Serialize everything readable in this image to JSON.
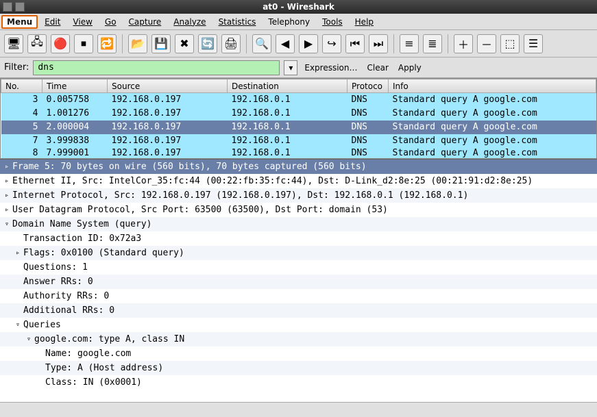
{
  "window": {
    "title": "at0 - Wireshark"
  },
  "menubar": {
    "menu_button": "Menu",
    "items": [
      "Edit",
      "View",
      "Go",
      "Capture",
      "Analyze",
      "Statistics",
      "Telephony",
      "Tools",
      "Help"
    ]
  },
  "toolbar_icons": {
    "if_list": "🖥",
    "if_opts": "🖧",
    "start": "🔴",
    "stop": "⏹",
    "restart": "🔁",
    "open": "📂",
    "save": "💾",
    "close": "✖",
    "reload": "🔄",
    "print": "🖨",
    "find": "🔍",
    "back": "◀",
    "fwd": "▶",
    "goto": "↪",
    "first": "⏮",
    "last": "⏭",
    "colorize": "≡",
    "autoscroll": "≣",
    "zoom_in": "＋",
    "zoom_out": "－",
    "zoom_100": "⬚",
    "cols": "☰"
  },
  "filter": {
    "label": "Filter:",
    "value": "dns",
    "expression": "Expression…",
    "clear": "Clear",
    "apply": "Apply"
  },
  "packet_columns": {
    "no": "No.",
    "time": "Time",
    "source": "Source",
    "dest": "Destination",
    "proto": "Protoco",
    "info": "Info"
  },
  "packets": [
    {
      "no": "3",
      "time": "0.005758",
      "src": "192.168.0.197",
      "dst": "192.168.0.1",
      "proto": "DNS",
      "info": "Standard query A google.com",
      "sel": false
    },
    {
      "no": "4",
      "time": "1.001276",
      "src": "192.168.0.197",
      "dst": "192.168.0.1",
      "proto": "DNS",
      "info": "Standard query A google.com",
      "sel": false
    },
    {
      "no": "5",
      "time": "2.000004",
      "src": "192.168.0.197",
      "dst": "192.168.0.1",
      "proto": "DNS",
      "info": "Standard query A google.com",
      "sel": true
    },
    {
      "no": "7",
      "time": "3.999838",
      "src": "192.168.0.197",
      "dst": "192.168.0.1",
      "proto": "DNS",
      "info": "Standard query A google.com",
      "sel": false
    },
    {
      "no": "8",
      "time": "7.999001",
      "src": "192.168.0.197",
      "dst": "192.168.0.1",
      "proto": "DNS",
      "info": "Standard query A google.com",
      "sel": false,
      "partial": true
    }
  ],
  "details": [
    {
      "text": "Frame 5: 70 bytes on wire (560 bits), 70 bytes captured (560 bits)",
      "indent": 0,
      "toggle": "▹",
      "headerSel": true
    },
    {
      "text": "Ethernet II, Src: IntelCor_35:fc:44 (00:22:fb:35:fc:44), Dst: D-Link_d2:8e:25 (00:21:91:d2:8e:25)",
      "indent": 0,
      "toggle": "▹"
    },
    {
      "text": "Internet Protocol, Src: 192.168.0.197 (192.168.0.197), Dst: 192.168.0.1 (192.168.0.1)",
      "indent": 0,
      "toggle": "▹"
    },
    {
      "text": "User Datagram Protocol, Src Port: 63500 (63500), Dst Port: domain (53)",
      "indent": 0,
      "toggle": "▹"
    },
    {
      "text": "Domain Name System (query)",
      "indent": 0,
      "toggle": "▿"
    },
    {
      "text": "Transaction ID: 0x72a3",
      "indent": 1,
      "toggle": ""
    },
    {
      "text": "Flags: 0x0100 (Standard query)",
      "indent": 1,
      "toggle": "▹"
    },
    {
      "text": "Questions: 1",
      "indent": 1,
      "toggle": ""
    },
    {
      "text": "Answer RRs: 0",
      "indent": 1,
      "toggle": ""
    },
    {
      "text": "Authority RRs: 0",
      "indent": 1,
      "toggle": ""
    },
    {
      "text": "Additional RRs: 0",
      "indent": 1,
      "toggle": ""
    },
    {
      "text": "Queries",
      "indent": 1,
      "toggle": "▿"
    },
    {
      "text": "google.com: type A, class IN",
      "indent": 2,
      "toggle": "▿"
    },
    {
      "text": "Name: google.com",
      "indent": 3,
      "toggle": ""
    },
    {
      "text": "Type: A (Host address)",
      "indent": 3,
      "toggle": ""
    },
    {
      "text": "Class: IN (0x0001)",
      "indent": 3,
      "toggle": ""
    }
  ]
}
